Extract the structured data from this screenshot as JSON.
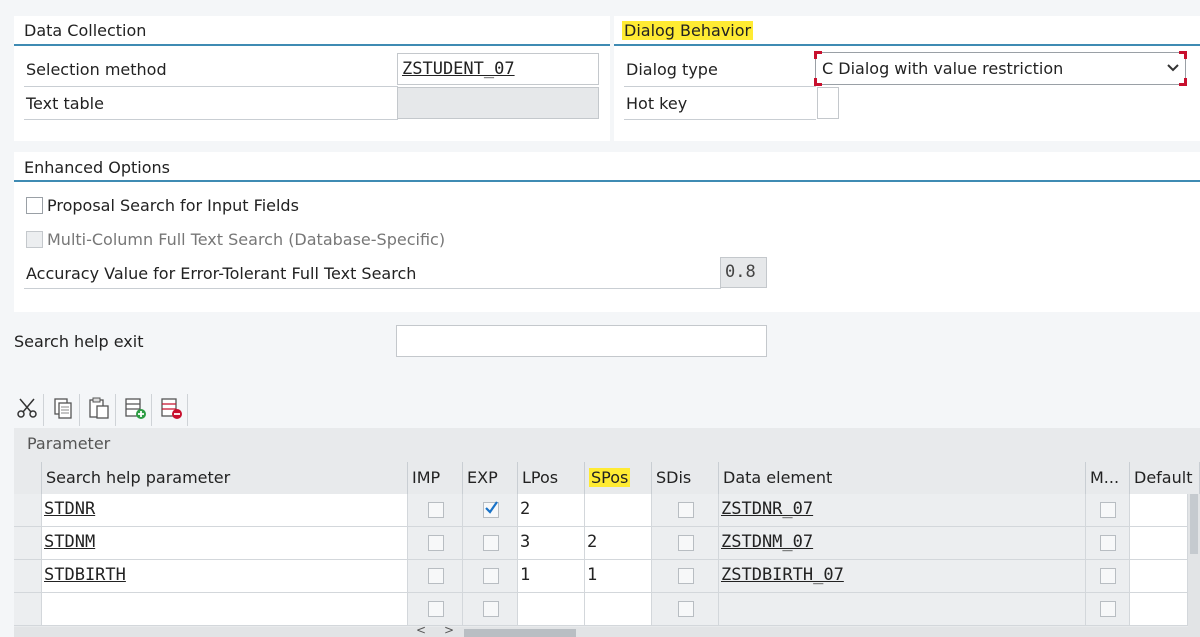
{
  "data_collection": {
    "title": "Data Collection",
    "selection_method_label": "Selection method",
    "selection_method_value": "ZSTUDENT_07",
    "text_table_label": "Text table",
    "text_table_value": ""
  },
  "dialog_behavior": {
    "title": "Dialog Behavior",
    "dialog_type_label": "Dialog type",
    "dialog_type_value": "C Dialog with value restriction",
    "hot_key_label": "Hot key",
    "hot_key_value": ""
  },
  "enhanced_options": {
    "title": "Enhanced Options",
    "proposal_search_label": "Proposal Search for Input Fields",
    "proposal_search_checked": false,
    "multi_column_label": "Multi-Column Full Text Search (Database-Specific)",
    "multi_column_checked": false,
    "accuracy_label": "Accuracy Value for Error-Tolerant Full Text Search",
    "accuracy_value": "0.8"
  },
  "search_help_exit": {
    "label": "Search help exit",
    "value": ""
  },
  "toolbar": {
    "icons": [
      "cut-icon",
      "copy-icon",
      "paste-icon",
      "insert-row-icon",
      "delete-row-icon"
    ]
  },
  "parameter_table": {
    "title": "Parameter",
    "columns": {
      "param": "Search help parameter",
      "imp": "IMP",
      "exp": "EXP",
      "lpos": "LPos",
      "spos": "SPos",
      "sdis": "SDis",
      "data_element": "Data element",
      "m": "M...",
      "default": "Default"
    },
    "rows": [
      {
        "param": "STDNR",
        "imp": false,
        "exp": true,
        "lpos": "2",
        "spos": "",
        "sdis": false,
        "data_element": "ZSTDNR_07",
        "m": false
      },
      {
        "param": "STDNM",
        "imp": false,
        "exp": false,
        "lpos": "3",
        "spos": "2",
        "sdis": false,
        "data_element": "ZSTDNM_07",
        "m": false
      },
      {
        "param": "STDBIRTH",
        "imp": false,
        "exp": false,
        "lpos": "1",
        "spos": "1",
        "sdis": false,
        "data_element": "ZSTDBIRTH_07",
        "m": false
      },
      {
        "param": "",
        "imp": false,
        "exp": false,
        "lpos": "",
        "spos": "",
        "sdis": false,
        "data_element": "",
        "m": false
      }
    ]
  },
  "colors": {
    "accent_line": "#3f8bb3",
    "highlight": "#ffeb33",
    "focus_red": "#c8102e",
    "check_blue": "#1a73c8"
  }
}
